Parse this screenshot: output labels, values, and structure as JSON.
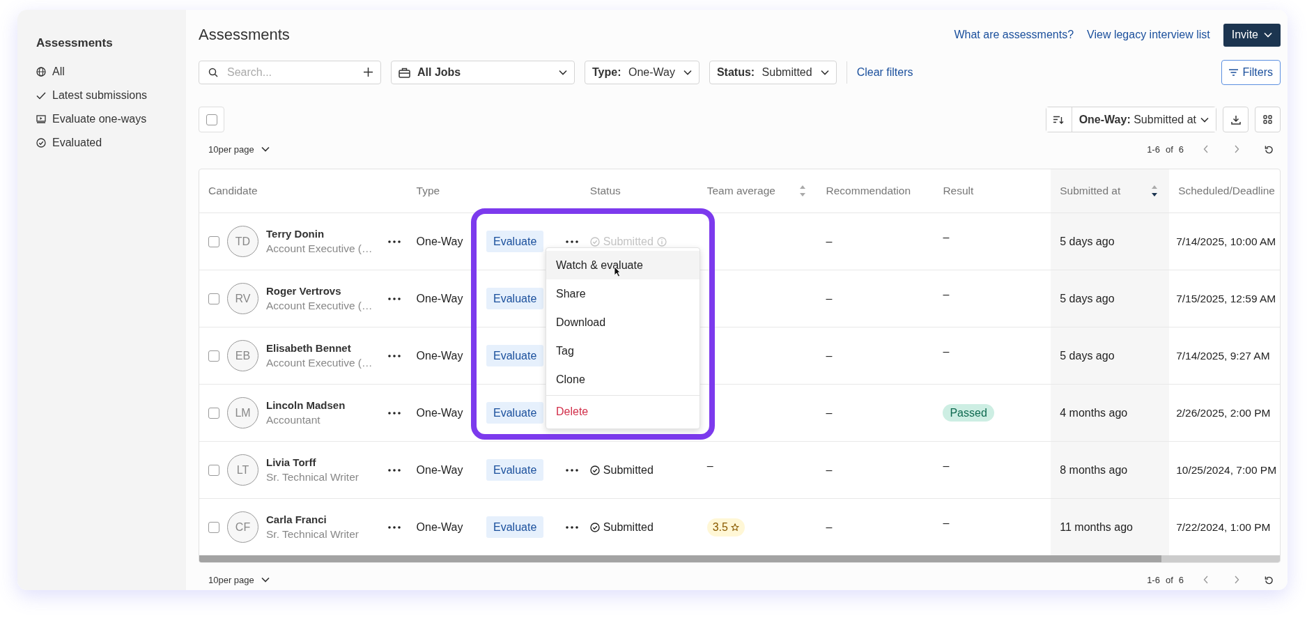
{
  "sidebar": {
    "title": "Assessments",
    "items": [
      {
        "label": "All",
        "kind": "globe"
      },
      {
        "label": "Latest submissions",
        "kind": "check"
      },
      {
        "label": "Evaluate one-ways",
        "kind": "screen"
      },
      {
        "label": "Evaluated",
        "kind": "done"
      }
    ]
  },
  "header": {
    "title": "Assessments",
    "links": [
      "What are assessments?",
      "View legacy interview list"
    ],
    "invite_button": "Invite"
  },
  "filters": {
    "search_placeholder": "Search...",
    "job_select": "All Jobs",
    "type": {
      "label": "Type:",
      "value": "One-Way"
    },
    "status": {
      "label": "Status:",
      "value": "Submitted"
    },
    "clear": "Clear filters",
    "filters_button": "Filters"
  },
  "toolbar": {
    "select_all_checked": false,
    "sort": {
      "label": "One-Way:",
      "value": "Submitted at"
    }
  },
  "pager_top": {
    "per_page": "10per page",
    "range": "1-6",
    "of": "of",
    "total": "6"
  },
  "table": {
    "columns": [
      {
        "label": "Candidate"
      },
      {
        "label": "Type"
      },
      {
        "label": "Status"
      },
      {
        "label": "Team average",
        "sorted": false
      },
      {
        "label": "Recommendation"
      },
      {
        "label": "Result"
      },
      {
        "label": "Submitted at",
        "sorted": true
      },
      {
        "label": "Scheduled/Deadline"
      }
    ],
    "rows": [
      {
        "checked": false,
        "initials": "TD",
        "name": "Terry Donin",
        "role": "Account Executive (…",
        "type": "One-Way",
        "evaluate": "Evaluate",
        "status": {
          "label": "Submitted",
          "muted": true
        },
        "recommendation": "–",
        "result": {
          "label": "–",
          "kind": "dash"
        },
        "submitted": "5 days ago",
        "deadline": "7/14/2025, 10:00 AM"
      },
      {
        "checked": false,
        "initials": "RV",
        "name": "Roger Vertrovs",
        "role": "Account Executive (…",
        "type": "One-Way",
        "evaluate": "Evaluate",
        "recommendation": "–",
        "result": {
          "label": "–",
          "kind": "dash"
        },
        "submitted": "5 days ago",
        "deadline": "7/15/2025, 12:59 AM"
      },
      {
        "checked": false,
        "initials": "EB",
        "name": "Elisabeth Bennet",
        "role": "Account Executive (…",
        "type": "One-Way",
        "evaluate": "Evaluate",
        "recommendation": "–",
        "result": {
          "label": "–",
          "kind": "dash"
        },
        "submitted": "5 days ago",
        "deadline": "7/14/2025, 9:27 AM"
      },
      {
        "checked": false,
        "initials": "LM",
        "name": "Lincoln Madsen",
        "role": "Accountant",
        "type": "One-Way",
        "evaluate": "Evaluate",
        "recommendation": "–",
        "result": {
          "label": "Passed",
          "kind": "badge"
        },
        "submitted": "4 months ago",
        "deadline": "2/26/2025, 2:00 PM"
      },
      {
        "checked": false,
        "initials": "LT",
        "name": "Livia Torff",
        "role": "Sr. Technical Writer",
        "type": "One-Way",
        "evaluate": "Evaluate",
        "status": {
          "label": "Submitted",
          "muted": false
        },
        "team_average": {
          "label": "–",
          "kind": "dash"
        },
        "recommendation": "–",
        "result": {
          "label": "–",
          "kind": "dash"
        },
        "submitted": "8 months ago",
        "deadline": "10/25/2024, 7:00 PM"
      },
      {
        "checked": false,
        "initials": "CF",
        "name": "Carla Franci",
        "role": "Sr. Technical Writer",
        "type": "One-Way",
        "evaluate": "Evaluate",
        "status": {
          "label": "Submitted",
          "muted": false
        },
        "team_average": {
          "label": "3.5",
          "kind": "rating"
        },
        "recommendation": "–",
        "result": {
          "label": "–",
          "kind": "dash"
        },
        "submitted": "11 months ago",
        "deadline": "7/22/2024, 1:00 PM"
      }
    ]
  },
  "menu": {
    "items": [
      {
        "label": "Watch & evaluate",
        "highlighted": true,
        "kind": "normal"
      },
      {
        "label": "Share",
        "highlighted": false,
        "kind": "normal"
      },
      {
        "label": "Download",
        "highlighted": false,
        "kind": "normal"
      },
      {
        "label": "Tag",
        "highlighted": false,
        "kind": "normal"
      },
      {
        "label": "Clone",
        "highlighted": false,
        "kind": "normal"
      },
      {
        "label": "Delete",
        "highlighted": false,
        "kind": "danger"
      }
    ]
  },
  "pager_bottom": {
    "per_page": "10per page",
    "range": "1-6",
    "of": "of",
    "total": "6"
  }
}
